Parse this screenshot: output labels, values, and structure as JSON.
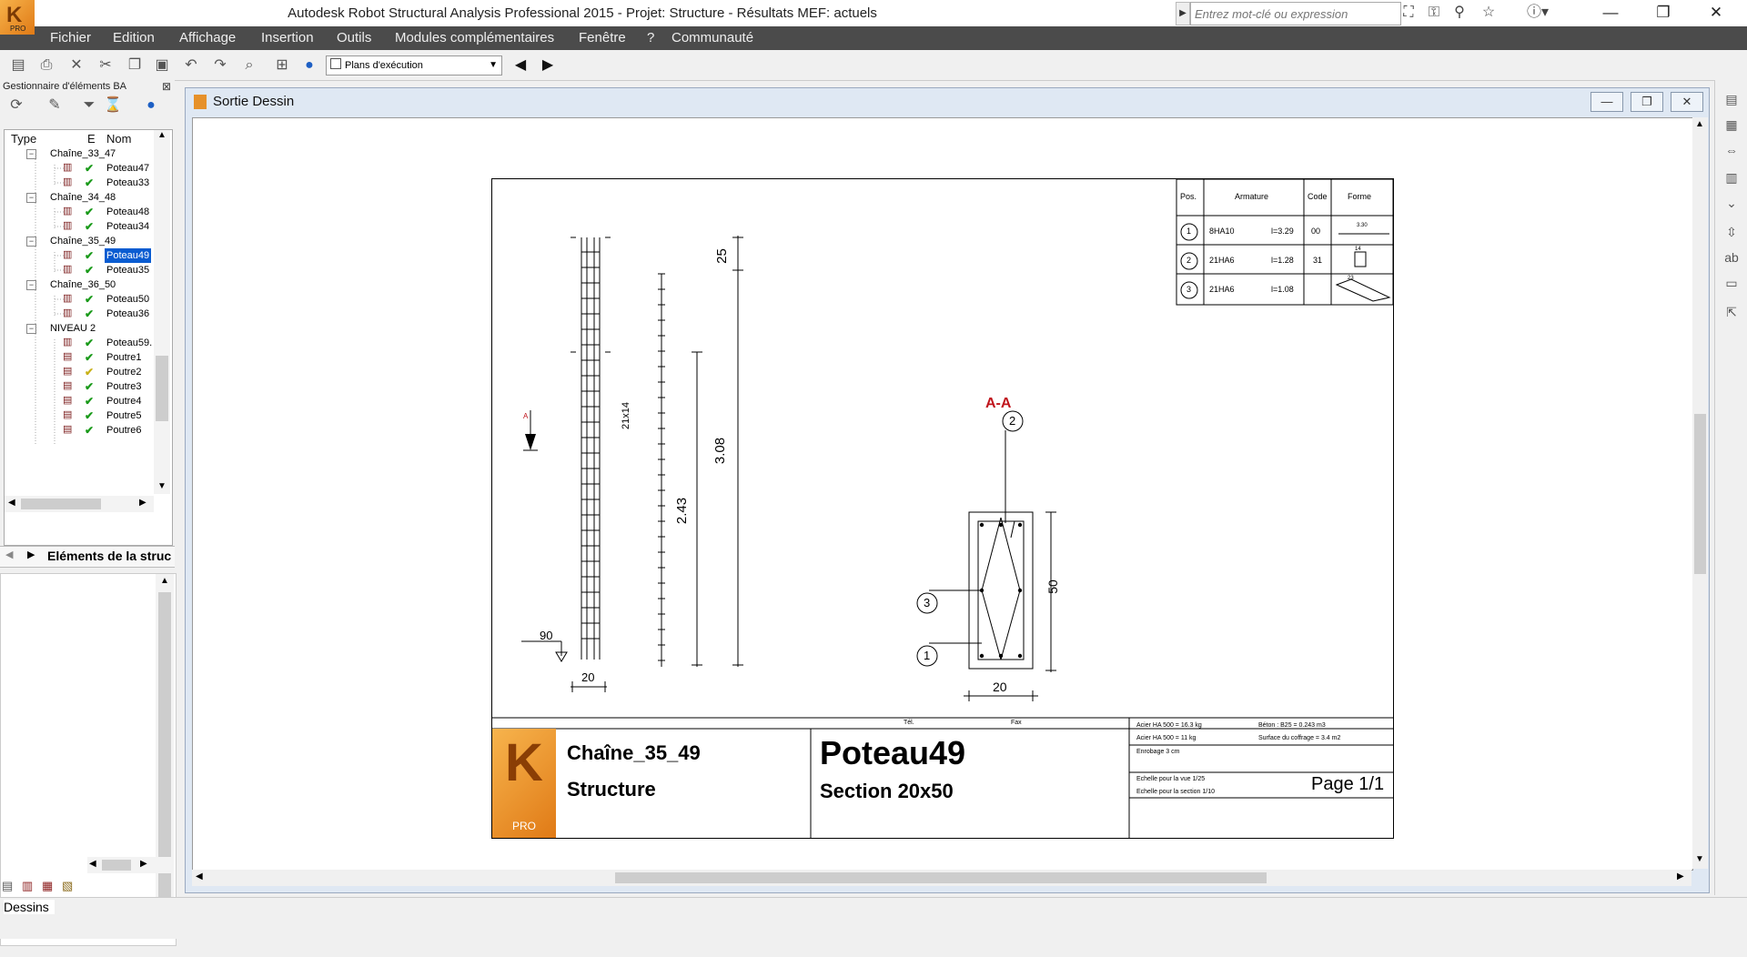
{
  "window": {
    "title": "Autodesk Robot Structural Analysis Professional 2015 - Projet: Structure - Résultats MEF: actuels",
    "logo_text": "PRO",
    "search_placeholder": "Entrez mot-clé ou expression",
    "minimize": "—",
    "restore": "❐",
    "close": "✕"
  },
  "menu": [
    "Fichier",
    "Edition",
    "Affichage",
    "Insertion",
    "Outils",
    "Modules complémentaires",
    "Fenêtre",
    "?",
    "Communauté"
  ],
  "toolbar": {
    "view_select": "Plans d'exécution"
  },
  "left_panel": {
    "title": "Gestionnaire d'éléments BA",
    "columns": [
      "Type",
      "E",
      "Nom"
    ],
    "tree": [
      {
        "level": 0,
        "label": "Chaîne_33_47"
      },
      {
        "level": 1,
        "label": "Poteau47",
        "status": "ok"
      },
      {
        "level": 1,
        "label": "Poteau33",
        "status": "ok"
      },
      {
        "level": 0,
        "label": "Chaîne_34_48"
      },
      {
        "level": 1,
        "label": "Poteau48",
        "status": "ok"
      },
      {
        "level": 1,
        "label": "Poteau34",
        "status": "ok"
      },
      {
        "level": 0,
        "label": "Chaîne_35_49"
      },
      {
        "level": 1,
        "label": "Poteau49",
        "status": "ok",
        "selected": true
      },
      {
        "level": 1,
        "label": "Poteau35",
        "status": "ok"
      },
      {
        "level": 0,
        "label": "Chaîne_36_50"
      },
      {
        "level": 1,
        "label": "Poteau50",
        "status": "ok"
      },
      {
        "level": 1,
        "label": "Poteau36",
        "status": "ok"
      },
      {
        "level": 0,
        "label": "NIVEAU 2"
      },
      {
        "level": 1,
        "label": "Poteau59.",
        "status": "ok"
      },
      {
        "level": 1,
        "label": "Poutre1",
        "status": "ok"
      },
      {
        "level": 1,
        "label": "Poutre2",
        "status": "warn"
      },
      {
        "level": 1,
        "label": "Poutre3",
        "status": "ok"
      },
      {
        "level": 1,
        "label": "Poutre4",
        "status": "ok"
      },
      {
        "level": 1,
        "label": "Poutre5",
        "status": "ok"
      },
      {
        "level": 1,
        "label": "Poutre6",
        "status": "ok"
      }
    ],
    "tab_label": "Eléments de la struc"
  },
  "document": {
    "title": "Sortie Dessin"
  },
  "drawing": {
    "schedule": {
      "headers": [
        "Pos.",
        "Armature",
        "Code",
        "Forme"
      ],
      "rows": [
        {
          "pos": "1",
          "bar": "8HA10",
          "length": "l=3.29",
          "code": "00",
          "shape_label": "3.30"
        },
        {
          "pos": "2",
          "bar": "21HA6",
          "length": "l=1.28",
          "code": "31",
          "shape_label": "14"
        },
        {
          "pos": "3",
          "bar": "21HA6",
          "length": "l=1.08",
          "code": "",
          "shape_label": "23"
        }
      ]
    },
    "dims": {
      "top": "25",
      "long": "3.08",
      "mid": "2.43",
      "stirrups": "21x14",
      "width_elev": "20",
      "hook": "90",
      "section_w": "20",
      "section_h": "50",
      "cut_mark": "A"
    },
    "section": {
      "title": "A-A",
      "bubbles": [
        "2",
        "3",
        "1"
      ]
    },
    "title_block": {
      "tel": "Tél.",
      "fax": "Fax",
      "chain": "Chaîne_35_49",
      "project": "Structure",
      "element": "Poteau49",
      "section": "Section 20x50",
      "steel1": "Acier HA 500 = 16.3 kg",
      "steel2": "Acier HA 500 = 11 kg",
      "concrete": "Béton : B25 = 0.243 m3",
      "formwork": "Surface du coffrage = 3.4 m2",
      "cover": "Enrobage 3 cm",
      "scale_view": "Echelle pour la vue 1/25",
      "scale_section": "Echelle pour la section 1/10",
      "page": "Page 1/1",
      "logo": "PRO"
    }
  },
  "status": {
    "text": "Dessins"
  },
  "colors": {
    "menu_bg": "#4b4b4b",
    "selection": "#0a5cd1",
    "section_title": "#c0141c",
    "check_ok": "#1a9a1a",
    "check_warn": "#c9b21a"
  }
}
